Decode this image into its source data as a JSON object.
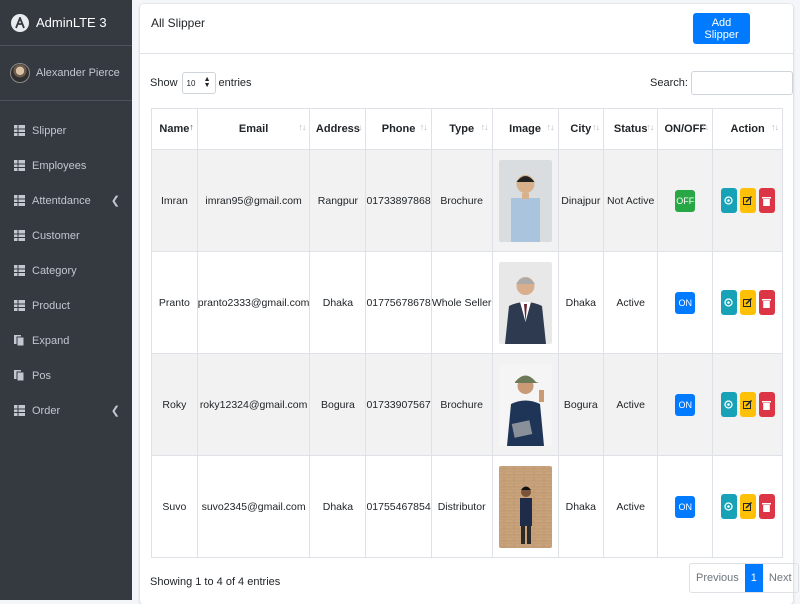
{
  "brand": {
    "name": "AdminLTE 3",
    "logo_icon": "adminlte-logo"
  },
  "user": {
    "name": "Alexander Pierce"
  },
  "sidebar": {
    "items": [
      {
        "label": "Slipper",
        "icon": "table-icon",
        "has_submenu": false
      },
      {
        "label": "Employees",
        "icon": "table-icon",
        "has_submenu": false
      },
      {
        "label": "Attentdance",
        "icon": "table-icon",
        "has_submenu": true
      },
      {
        "label": "Customer",
        "icon": "table-icon",
        "has_submenu": false
      },
      {
        "label": "Category",
        "icon": "table-icon",
        "has_submenu": false
      },
      {
        "label": "Product",
        "icon": "table-icon",
        "has_submenu": false
      },
      {
        "label": "Expand",
        "icon": "copy-icon",
        "has_submenu": false
      },
      {
        "label": "Pos",
        "icon": "copy-icon",
        "has_submenu": false
      },
      {
        "label": "Order",
        "icon": "table-icon",
        "has_submenu": true
      }
    ]
  },
  "card": {
    "title": "All Slipper",
    "add_button": "Add Slipper"
  },
  "controls": {
    "show_label": "Show",
    "entries_value": "10",
    "entries_label": "entries",
    "search_label": "Search:"
  },
  "table": {
    "columns": [
      "Name",
      "Email",
      "Address",
      "Phone",
      "Type",
      "Image",
      "City",
      "Status",
      "ON/OFF",
      "Action"
    ],
    "rows": [
      {
        "name": "Imran",
        "email": "imran95@gmail.com",
        "address": "Rangpur",
        "phone": "01733897868",
        "type": "Brochure",
        "city": "Dinajpur",
        "status": "Not Active",
        "toggle": "OFF"
      },
      {
        "name": "Pranto",
        "email": "pranto2333@gmail.com",
        "address": "Dhaka",
        "phone": "01775678678",
        "type": "Whole Seller",
        "city": "Dhaka",
        "status": "Active",
        "toggle": "ON"
      },
      {
        "name": "Roky",
        "email": "roky12324@gmail.com",
        "address": "Bogura",
        "phone": "01733907567",
        "type": "Brochure",
        "city": "Bogura",
        "status": "Active",
        "toggle": "ON"
      },
      {
        "name": "Suvo",
        "email": "suvo2345@gmail.com",
        "address": "Dhaka",
        "phone": "01755467854",
        "type": "Distributor",
        "city": "Dhaka",
        "status": "Active",
        "toggle": "ON"
      }
    ]
  },
  "footer": {
    "info": "Showing 1 to 4 of 4 entries",
    "previous": "Previous",
    "current_page": "1",
    "next": "Next"
  },
  "colors": {
    "primary": "#007bff",
    "success": "#28a745",
    "info": "#17a2b8",
    "warning": "#ffc107",
    "danger": "#dc3545",
    "sidebar": "#343a40"
  }
}
